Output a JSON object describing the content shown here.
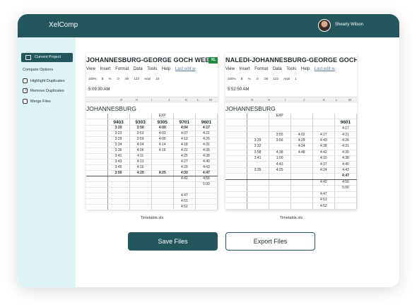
{
  "app": {
    "title": "XelComp",
    "user": "Shearly Wilson"
  },
  "sidebar": {
    "project_button": "Current Project",
    "compare_title": "Compare Options",
    "options": [
      {
        "label": "Highlight Duplicates",
        "checked": false
      },
      {
        "label": "Remove Duplicates",
        "checked": true
      },
      {
        "label": "Merge Files",
        "checked": false
      }
    ]
  },
  "sheets": [
    {
      "title": "JOHANNESBURG-GEORGE GOCH WEEK",
      "badge": "XL",
      "menu": [
        "View",
        "Insert",
        "Format",
        "Data",
        "Tools",
        "Help"
      ],
      "last_edit": "Last edit w",
      "toolbar": [
        "100%",
        "$",
        "%",
        ".0",
        ".00",
        "123",
        "Arial",
        "10"
      ],
      "formula": "5:09:30 AM",
      "columns": [
        "G",
        "H",
        "I",
        "J",
        "K",
        "L",
        "M"
      ],
      "heading": "JOHANNESBURG",
      "exp": "EXP",
      "train_numbers": [
        "9403",
        "9303",
        "9305",
        "9701",
        "9601"
      ],
      "rows": [
        [
          "",
          "3:20",
          "3:50",
          "4:00",
          "4:04",
          "4:17"
        ],
        [
          "",
          "3:23",
          "3:53",
          "4:03",
          "4:07",
          "4:21"
        ],
        [
          "",
          "3:29",
          "3:59",
          "4:09",
          "4:13",
          "4:26"
        ],
        [
          "",
          "3:34",
          "4:04",
          "4:14",
          "4:18",
          "4:31"
        ],
        [
          "",
          "3:36",
          "4:06",
          "4:16",
          "4:22",
          "4:35"
        ],
        [
          "",
          "3:41",
          "4:11",
          "",
          "4:25",
          "4:38"
        ],
        [
          "",
          "3:43",
          "4:13",
          "",
          "4:27",
          "4:40"
        ],
        [
          "",
          "3:45",
          "4:15",
          "",
          "4:29",
          "4:43"
        ],
        [
          "",
          "3:50",
          "4:20",
          "4:25",
          "4:33",
          "4:47"
        ],
        [
          "",
          "",
          "",
          "",
          "4:42",
          "4:56"
        ],
        [
          "",
          "",
          "",
          "",
          "",
          "5:00"
        ],
        [
          "",
          "",
          "",
          "",
          "",
          ""
        ],
        [
          "",
          "",
          "",
          "",
          "4:47",
          ""
        ],
        [
          "",
          "",
          "",
          "",
          "4:51",
          ""
        ],
        [
          "",
          "",
          "",
          "",
          "4:52",
          ""
        ]
      ],
      "caption": "Timetable.xls"
    },
    {
      "title": "NALEDI-JOHANNESBURG-GEORGE GOCH W",
      "badge": "",
      "menu": [
        "View",
        "Insert",
        "Format",
        "Data",
        "Tools",
        "Help"
      ],
      "last_edit": "Last edit w",
      "toolbar": [
        "100%",
        "$",
        "%",
        ".0",
        ".00",
        "123",
        "Arial",
        "1"
      ],
      "formula": "5:52:50 AM",
      "columns": [
        "G",
        "H",
        "I",
        "J",
        "K",
        "L",
        "M"
      ],
      "heading": "JOHANNESBURG",
      "exp": "EXP",
      "train_numbers": [
        "",
        "",
        "",
        "",
        "9601"
      ],
      "rows": [
        [
          "",
          "",
          "",
          "",
          "",
          "4:17"
        ],
        [
          "",
          "",
          "3:55",
          "4:02",
          "4:27",
          "4:21"
        ],
        [
          "",
          "3:29",
          "3:56",
          "4:29",
          "4:43",
          "4:26"
        ],
        [
          "",
          "3:32",
          "",
          "4:24",
          "4:38",
          "4:31"
        ],
        [
          "",
          "3:58",
          "4:38",
          "4:48",
          "4:42",
          "4:35"
        ],
        [
          "",
          "3:41",
          "1:00",
          "",
          "4:15",
          "4:38"
        ],
        [
          "",
          "",
          "4:43",
          "",
          "4:37",
          "4:40"
        ],
        [
          "",
          "3:35",
          "4:25",
          "",
          "4:24",
          "4:43"
        ],
        [
          "",
          "",
          "",
          "",
          "",
          "4:47"
        ],
        [
          "",
          "",
          "",
          "",
          "4:42",
          "4:56"
        ],
        [
          "",
          "",
          "",
          "",
          "",
          "5:00"
        ],
        [
          "",
          "",
          "",
          "",
          "4:47",
          ""
        ],
        [
          "",
          "",
          "",
          "",
          "4:51",
          ""
        ],
        [
          "",
          "",
          "",
          "",
          "4:52",
          ""
        ]
      ],
      "caption": "Timetable.xls"
    }
  ],
  "actions": {
    "save": "Save Files",
    "export": "Export Files"
  },
  "colors": {
    "primary": "#23575c",
    "sidebar_bg": "#dff3f6",
    "badge": "#1f8a3e"
  }
}
